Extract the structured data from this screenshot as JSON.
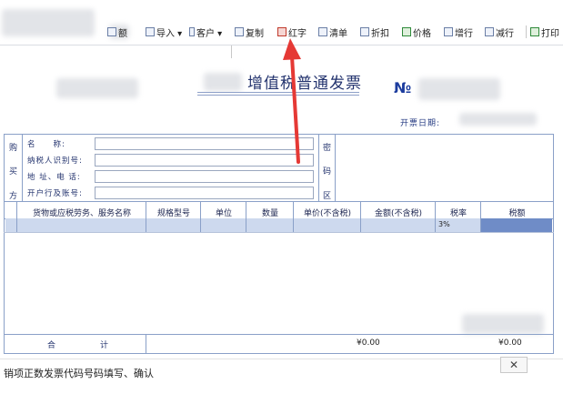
{
  "toolbar": {
    "items": [
      {
        "label": "额",
        "icon": "doc-icon"
      },
      {
        "label": "导入 ▾",
        "icon": "import-icon"
      },
      {
        "label": "客户 ▾",
        "icon": "customer-icon"
      },
      {
        "label": "复制",
        "icon": "copy-icon"
      },
      {
        "label": "红字",
        "icon": "red-letter-icon"
      },
      {
        "label": "清单",
        "icon": "list-icon"
      },
      {
        "label": "折扣",
        "icon": "discount-icon"
      },
      {
        "label": "价格",
        "icon": "price-icon"
      },
      {
        "label": "增行",
        "icon": "add-row-icon"
      },
      {
        "label": "减行",
        "icon": "remove-row-icon"
      },
      {
        "label": "打印",
        "icon": "print-icon"
      }
    ]
  },
  "invoice": {
    "title": "增值税普通发票",
    "number_symbol": "№",
    "issue_date_label": "开票日期:",
    "buyer_side": [
      "购",
      "买",
      "方"
    ],
    "buyer_fields": {
      "name": "名　　称:",
      "tax_id": "纳税人识别号:",
      "address_phone": "地 址、电 话:",
      "bank_account": "开户行及账号:"
    },
    "cipher_side": [
      "密",
      "码",
      "区"
    ],
    "columns": {
      "goods": "货物或应税劳务、服务名称",
      "spec": "规格型号",
      "unit": "单位",
      "qty": "数量",
      "price": "单价(不含税)",
      "amount": "金额(不含税)",
      "rate": "税率",
      "tax": "税额"
    },
    "first_row": {
      "rate": "3%"
    },
    "total": {
      "label_he": "合",
      "label_ji": "计",
      "amount": "¥0.00",
      "tax": "¥0.00"
    }
  },
  "status": {
    "message": "销项正数发票代码号码填写、确认",
    "close_label": "✕"
  },
  "colors": {
    "accent": "#23336e",
    "highlight_row": "#cdd9ee",
    "tax_cell": "#6f8cc7",
    "arrow": "#e53935"
  }
}
